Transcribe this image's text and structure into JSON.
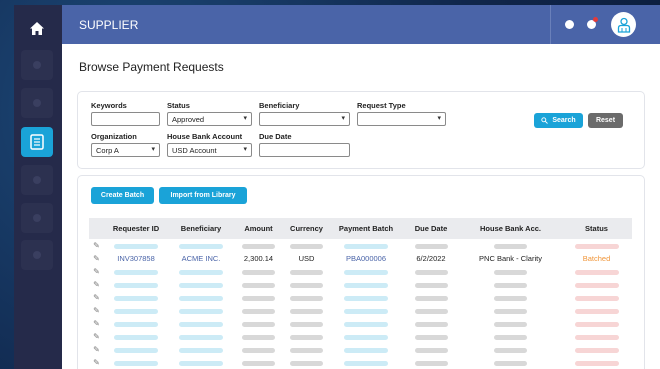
{
  "app": {
    "title": "SUPPLIER",
    "page_title": "Browse Payment Requests"
  },
  "filters": {
    "keywords_label": "Keywords",
    "keywords_value": "",
    "status_label": "Status",
    "status_value": "Approved",
    "beneficiary_label": "Beneficiary",
    "beneficiary_value": "",
    "request_type_label": "Request Type",
    "request_type_value": "",
    "organization_label": "Organization",
    "organization_value": "Corp A",
    "house_bank_label": "House Bank Account",
    "house_bank_value": "USD Account",
    "due_date_label": "Due Date",
    "due_date_value": "",
    "search_label": "Search",
    "reset_label": "Reset"
  },
  "actions": {
    "create_batch": "Create Batch",
    "import_library": "Import from Library"
  },
  "table": {
    "columns": [
      "Requester ID",
      "Beneficiary",
      "Amount",
      "Currency",
      "Payment Batch",
      "Due Date",
      "House Bank Acc.",
      "Status"
    ],
    "row": {
      "requester_id": "INV307858",
      "beneficiary": "ACME INC.",
      "amount": "2,300.14",
      "currency": "USD",
      "payment_batch": "PBA000006",
      "due_date": "6/2/2022",
      "house_bank": "PNC Bank - Clarity",
      "status": "Batched"
    }
  },
  "colors": {
    "topbar": "#4a64a8",
    "accent": "#1aa3d8",
    "sidebar": "#252a4a",
    "batched": "#f0963a"
  },
  "icons": [
    "home-icon",
    "document-list-icon",
    "search-icon",
    "user-icon",
    "notification-icon",
    "pencil-icon",
    "chevron-down-icon"
  ]
}
